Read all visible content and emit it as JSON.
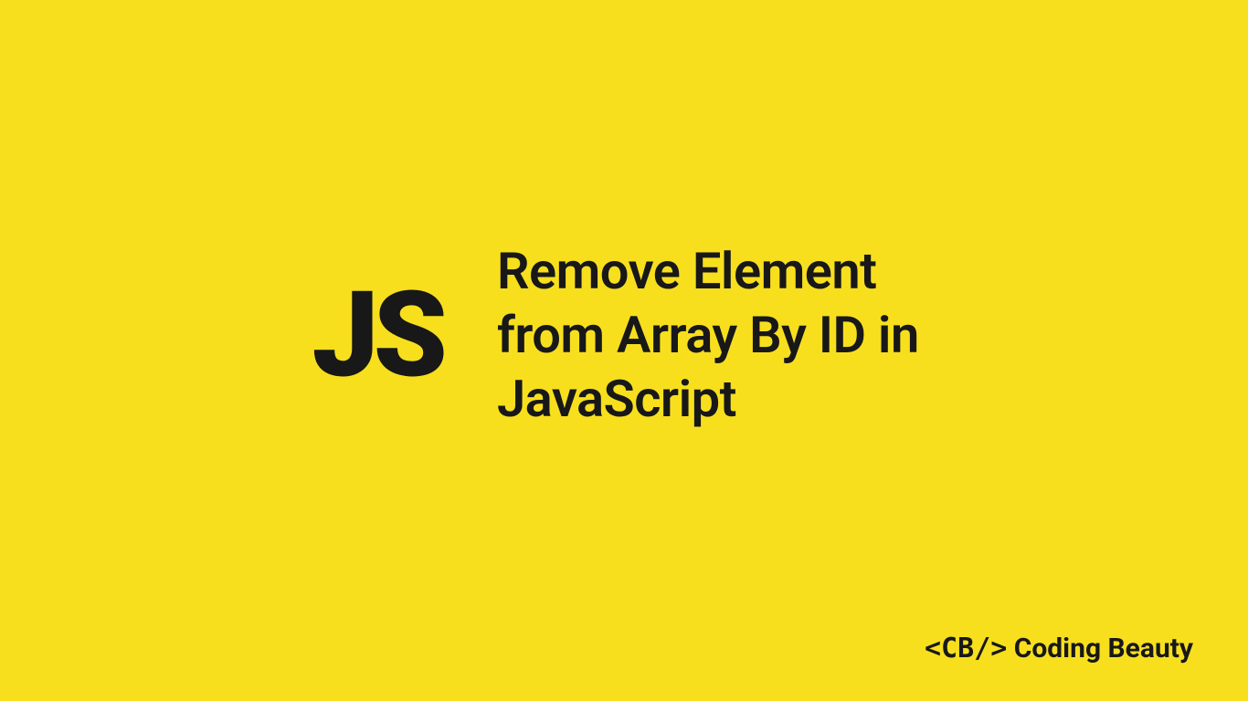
{
  "badge": {
    "label": "JS"
  },
  "heading": {
    "text": "Remove Element from Array By ID in JavaScript"
  },
  "brand": {
    "tag": "<CB/>",
    "name": "Coding Beauty"
  },
  "colors": {
    "background": "#f7df1e",
    "text": "#181818"
  }
}
